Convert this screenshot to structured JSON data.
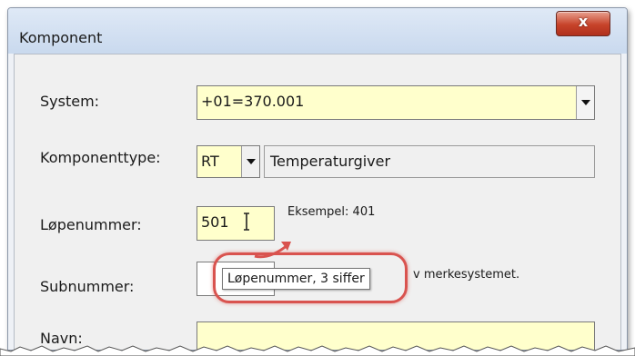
{
  "window": {
    "title": "Komponent",
    "close_glyph": "x"
  },
  "form": {
    "system_label": "System:",
    "system_value": "+01=370.001",
    "komponenttype_label": "Komponenttype:",
    "komponenttype_code": "RT",
    "komponenttype_name": "Temperaturgiver",
    "lopenummer_label": "Løpenummer:",
    "lopenummer_value": "501",
    "lopenummer_example": "Eksempel: 401",
    "subnummer_label": "Subnummer:",
    "subnummer_value": "",
    "subnummer_hint": "v merkesystemet.",
    "navn_label": "Navn:",
    "navn_value": ""
  },
  "tooltip": {
    "text": "Løpenummer, 3 siffer"
  },
  "colors": {
    "field_bg": "#ffffcc",
    "highlight": "#d9534f",
    "close_button": "#c7432a"
  },
  "icons": [
    "close-icon",
    "chevron-down-icon",
    "text-cursor-icon"
  ]
}
